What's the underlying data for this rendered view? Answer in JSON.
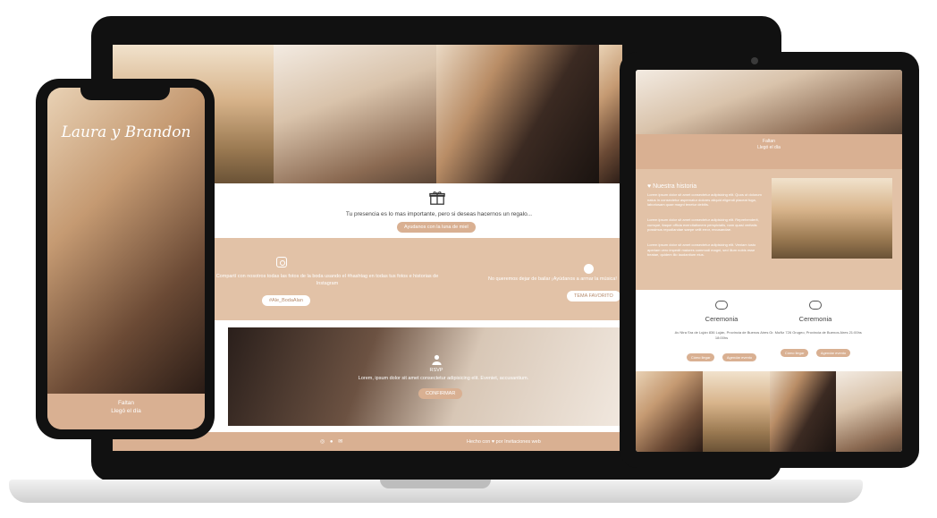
{
  "laptop": {
    "gift_text": "Tu presencia es lo mas importante, pero si deseas hacernos un regalo...",
    "gift_button": "Ayudanos con la luna de miel",
    "instagram_text": "Compartí con nosotros todas las fotos de la boda usando el #hashtag en todas tus fotos e historias de Instagram",
    "instagram_button": "#Ale_BodaAlan",
    "music_text": "No queremos dejar de bailar ¡Ayúdanos a armar la música!",
    "music_button": "TEMA FAVORITO",
    "rsvp_label": "RSVP",
    "rsvp_text": "Lorem, ipsum dolor sit amet consectetur adipisicing elit. Eveniet, accusantium.",
    "rsvp_button": "CONFIRMAR",
    "footer_icons": "◎ ● ✉",
    "footer_credit": "Hecho con ♥ por Invitaciones web"
  },
  "phone": {
    "names": "Laura y Brandon",
    "footer_line1": "Faltan",
    "footer_line2": "Llegó el día"
  },
  "tablet": {
    "band_line1": "Faltan",
    "band_line2": "Llegó el día",
    "story_title": "♥ Nuestra historia",
    "story_p1": "Lorem ipsum dolor sit amet consectetur adipisicing elit. Quos ut dolorum natus in consectetur aspernatur dolores aliquid eligendi placeat fuga, laboriosam quae magni tenetur debitis.",
    "story_p2": "Lorem ipsum dolor sit amet consectetur adipisicing elit. Reprehenderit, cumque, itaque officia exercitationem perspiciatis, nam quasi veritatis possimus repudiandae saepe velit error, recusandae.",
    "story_p3": "Lorem ipsum dolor sit amet consectetur adipisicing elit. Veniam iusto aperiam vero impedit maiores commodi magni, sed illum nobis esse beatae, quidem illo laudantium eius.",
    "ceremony_title": "Ceremonia",
    "ceremony_address": "Av Ntra Sra de Luján 836 Luján, Provincia de Buenos Aires 18:00hs",
    "ceremony_btn1": "Cómo llegar",
    "ceremony_btn2": "Agendar evento",
    "party_title": "Ceremonia",
    "party_address": "Gr. Muñiz 726 Grugeo, Provincia de Buenos Aires 21:00hs",
    "party_btn1": "Cómo llegar",
    "party_btn2": "Agendar evento"
  },
  "colors": {
    "accent": "#d9b092",
    "beige": "#e2c2a7",
    "device_frame": "#111111"
  }
}
